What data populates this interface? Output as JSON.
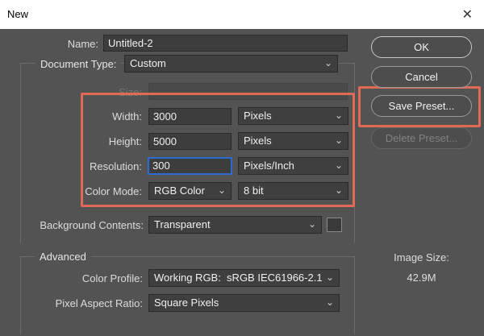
{
  "window": {
    "title": "New",
    "close_glyph": "✕"
  },
  "fields": {
    "name_label": "Name:",
    "name_value": "Untitled-2",
    "doctype_label": "Document Type:",
    "doctype_value": "Custom",
    "size_label": "Size:",
    "size_value": "",
    "width_label": "Width:",
    "width_value": "3000",
    "width_unit": "Pixels",
    "height_label": "Height:",
    "height_value": "5000",
    "height_unit": "Pixels",
    "resolution_label": "Resolution:",
    "resolution_value": "300",
    "resolution_unit": "Pixels/Inch",
    "colormode_label": "Color Mode:",
    "colormode_value": "RGB Color",
    "bitdepth_value": "8 bit",
    "background_label": "Background Contents:",
    "background_value": "Transparent"
  },
  "advanced": {
    "legend": "Advanced",
    "color_profile_label": "Color Profile:",
    "color_profile_value": "Working RGB:  sRGB IEC61966-2.1",
    "pixel_aspect_label": "Pixel Aspect Ratio:",
    "pixel_aspect_value": "Square Pixels"
  },
  "buttons": {
    "ok": "OK",
    "cancel": "Cancel",
    "save_preset": "Save Preset...",
    "delete_preset": "Delete Preset..."
  },
  "image_size": {
    "label": "Image Size:",
    "value": "42.9M"
  },
  "icons": {
    "chevron": "⌄"
  },
  "colors": {
    "dialog_bg": "#535353",
    "highlight": "#e06a55",
    "focus": "#2d6bd1"
  }
}
